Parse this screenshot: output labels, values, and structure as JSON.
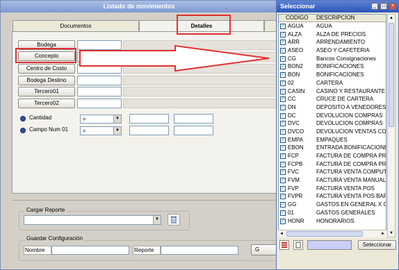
{
  "main_window": {
    "title": "Listado de movimientos",
    "tabs": [
      {
        "label": "Documentos"
      },
      {
        "label": "Detalles"
      }
    ],
    "filter_buttons": [
      "Bodega",
      "Concepto",
      "Centro de Costo",
      "Bodega Destino",
      "Tercero01",
      "Tercero02"
    ],
    "ranges": [
      {
        "label": "Cantidad",
        "operator": "="
      },
      {
        "label": "Campo Num 01",
        "operator": "="
      }
    ],
    "cargar_reporte": {
      "label": "Cargar Reporte"
    },
    "guardar_config": {
      "label": "Guardar Configuración",
      "nombre_label": "Nombre",
      "reporte_label": "Reporte",
      "button_partial": "G"
    }
  },
  "selector_window": {
    "title": "Seleccionar",
    "columns": [
      "CODIGO",
      "DESCRIPCION"
    ],
    "rows": [
      {
        "code": "AGUA",
        "desc": "AGUA"
      },
      {
        "code": "ALZA",
        "desc": "ALZA DE PRECIOS"
      },
      {
        "code": "ARR",
        "desc": "ARRENDAMIENTO"
      },
      {
        "code": "ASEO",
        "desc": "ASEO Y CAFETERIA"
      },
      {
        "code": "CG",
        "desc": "Bancos Consignaciones"
      },
      {
        "code": "BON2",
        "desc": "BONIFICACIONES"
      },
      {
        "code": "BON",
        "desc": "BONIFICACIONES"
      },
      {
        "code": "02",
        "desc": "CARTERA"
      },
      {
        "code": "CASIN",
        "desc": "CASINO Y RESTAURANTE"
      },
      {
        "code": "CC",
        "desc": "CRUCE DE CARTERA"
      },
      {
        "code": "DN",
        "desc": "DEPOSITO A VENEDORES"
      },
      {
        "code": "DC",
        "desc": "DEVOLUCION COMPRAS"
      },
      {
        "code": "DVC",
        "desc": "DEVOLUCION COMPRAS"
      },
      {
        "code": "DVCO",
        "desc": "DEVOLUCION VENTAS CO"
      },
      {
        "code": "EMPA",
        "desc": "EMPAQUES"
      },
      {
        "code": "EBON",
        "desc": "ENTRADA BONIFICACIONE"
      },
      {
        "code": "FCP",
        "desc": "FACTURA DE COMPRA PR"
      },
      {
        "code": "FCPB",
        "desc": "FACTURA DE COMPRA PR"
      },
      {
        "code": "FVC",
        "desc": "FACTURA VENTA COMPUT"
      },
      {
        "code": "FVM",
        "desc": "FACTURA VENTA MANUAL"
      },
      {
        "code": "FVP",
        "desc": "FACTURA VENTA POS"
      },
      {
        "code": "FVPR",
        "desc": "FACTURA VENTA POS BAF"
      },
      {
        "code": "GG",
        "desc": "GASTOS EN GENERAL X C"
      },
      {
        "code": "01",
        "desc": "GASTOS GENERALES"
      },
      {
        "code": "HONR",
        "desc": "HONORARIOS"
      }
    ],
    "select_button": "Seleccionar",
    "window_controls": [
      "_",
      "□",
      "×"
    ]
  }
}
